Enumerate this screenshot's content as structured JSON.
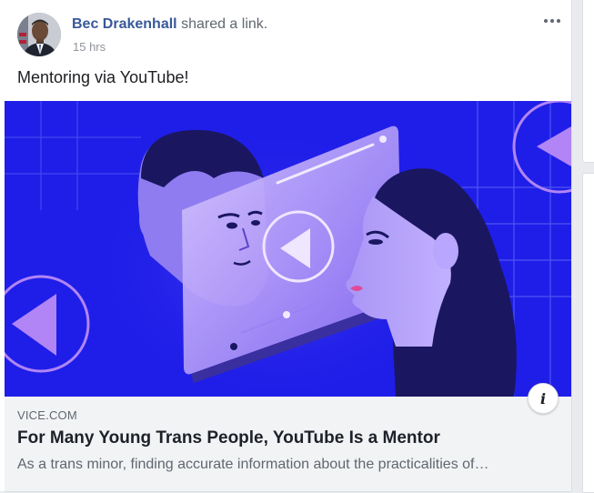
{
  "post": {
    "author": "Bec Drakenhall",
    "action": "shared a link.",
    "time": "15 hrs",
    "text": "Mentoring via YouTube!"
  },
  "link_preview": {
    "domain": "VICE.COM",
    "title": "For Many Young Trans People, YouTube Is a Mentor",
    "description": "As a trans minor, finding accurate information about the practicalities of…",
    "info_icon_glyph": "i"
  },
  "icons": {
    "more": "more-options-icon",
    "info": "info-icon"
  },
  "colors": {
    "author_link": "#385898",
    "hero_background": "#1f1ee8",
    "hero_accent": "#b185f5",
    "footer_background": "#f2f3f5"
  }
}
